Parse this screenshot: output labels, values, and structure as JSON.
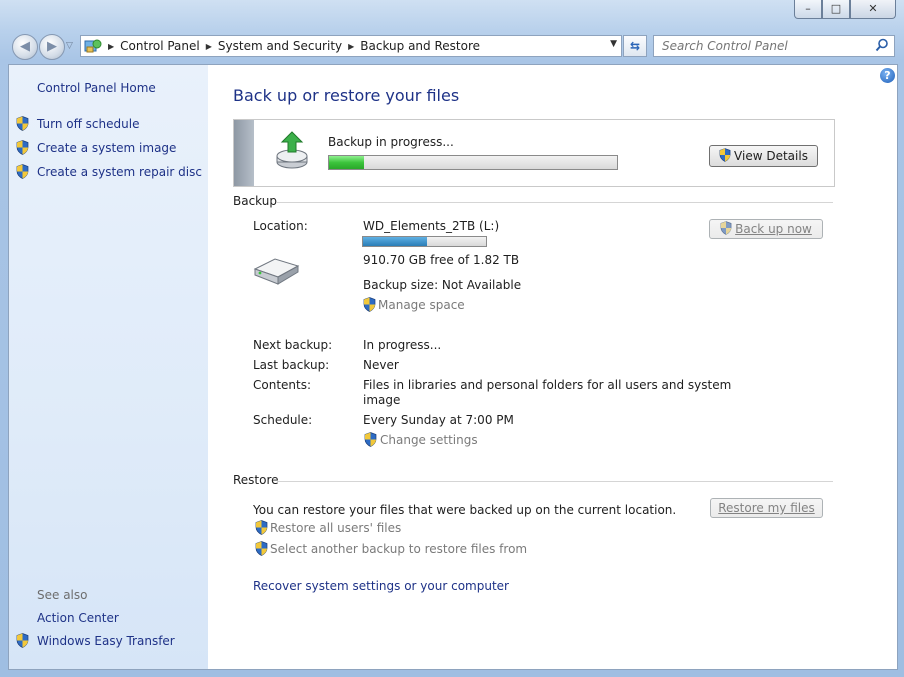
{
  "window": {
    "controls": {
      "minimize": "–",
      "maximize": "□",
      "close": "✕"
    }
  },
  "address_bar": {
    "crumbs": [
      "Control Panel",
      "System and Security",
      "Backup and Restore"
    ]
  },
  "search": {
    "placeholder": "Search Control Panel"
  },
  "sidebar": {
    "home": "Control Panel Home",
    "tasks": [
      "Turn off schedule",
      "Create a system image",
      "Create a system repair disc"
    ],
    "see_also_title": "See also",
    "see_also": [
      "Action Center",
      "Windows Easy Transfer"
    ]
  },
  "main": {
    "title": "Back up or restore your files",
    "progress": {
      "label": "Backup in progress...",
      "fraction": 0.12,
      "view_details": "View Details"
    },
    "backup": {
      "section_title": "Backup",
      "location_label": "Location:",
      "location_value": "WD_Elements_2TB (L:)",
      "disk_used_fraction": 0.52,
      "free_space": "910.70 GB free of 1.82 TB",
      "backup_size": "Backup size: Not Available",
      "manage_space": "Manage space",
      "back_up_now": "Back up now",
      "next_backup_label": "Next backup:",
      "next_backup_value": "In progress...",
      "last_backup_label": "Last backup:",
      "last_backup_value": "Never",
      "contents_label": "Contents:",
      "contents_value_line1": "Files in libraries and personal folders for all users and system",
      "contents_value_line2": "image",
      "schedule_label": "Schedule:",
      "schedule_value": "Every Sunday at 7:00 PM",
      "change_settings": "Change settings"
    },
    "restore": {
      "section_title": "Restore",
      "description": "You can restore your files that were backed up on the current location.",
      "restore_my_files": "Restore my files",
      "restore_all_users": "Restore all users' files",
      "select_another": "Select another backup to restore files from",
      "recover_system": "Recover system settings or your computer"
    }
  },
  "colors": {
    "link_blue": "#1e3287",
    "progress_green": "#3cc43c",
    "disk_bar": "#2a7db6"
  }
}
